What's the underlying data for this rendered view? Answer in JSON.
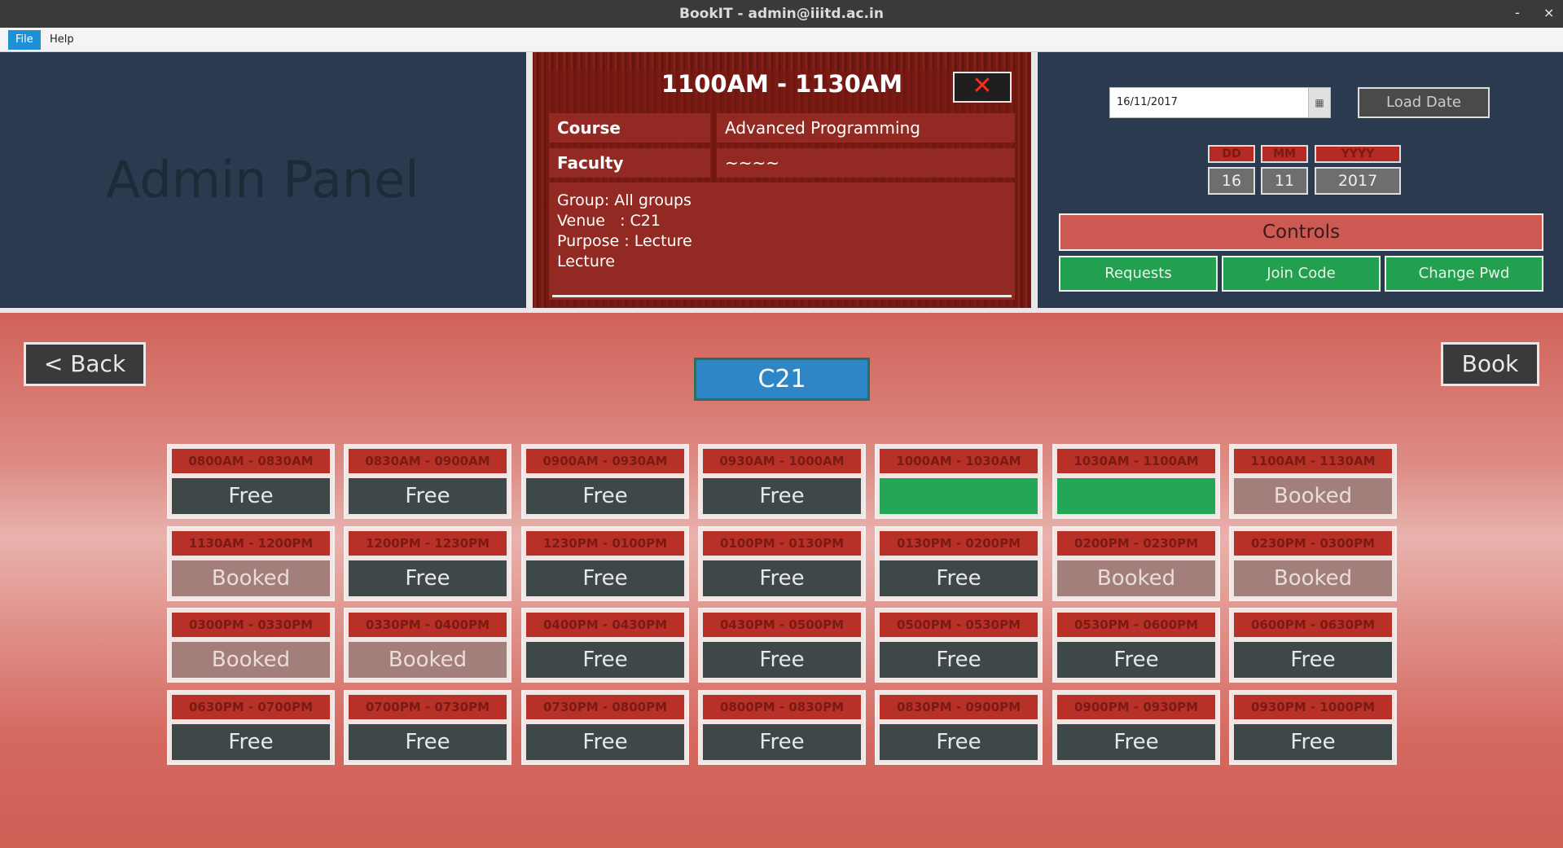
{
  "window": {
    "title": "BookIT - admin@iiitd.ac.in",
    "minimize": "-",
    "close": "×"
  },
  "menu": {
    "items": [
      "File",
      "Help"
    ]
  },
  "panel_title": "Admin Panel",
  "popup": {
    "slot": "1100AM - 1130AM",
    "close": "✕",
    "course_label": "Course",
    "course_value": "Advanced Programming",
    "faculty_label": "Faculty",
    "faculty_value": "~~~~",
    "details": "Group: All groups\nVenue   : C21\nPurpose : Lecture\nLecture"
  },
  "date_picker": {
    "value": "16/11/2017",
    "calendar_icon": "calendar-icon",
    "load_label": "Load Date",
    "dd_label": "DD",
    "mm_label": "MM",
    "yyyy_label": "YYYY",
    "dd": "16",
    "mm": "11",
    "yyyy": "2017"
  },
  "controls": {
    "title": "Controls",
    "requests": "Requests",
    "join_code": "Join Code",
    "change_pwd": "Change Pwd"
  },
  "nav": {
    "back": "< Back",
    "book": "Book"
  },
  "room": "C21",
  "colors": {
    "free": "#3e4849",
    "booked": "#a37f7c",
    "selected": "#24a657",
    "slot_header": "#b83128"
  },
  "slots": [
    {
      "time": "0800AM - 0830AM",
      "status": "Free",
      "state": "free"
    },
    {
      "time": "0830AM - 0900AM",
      "status": "Free",
      "state": "free"
    },
    {
      "time": "0900AM - 0930AM",
      "status": "Free",
      "state": "free"
    },
    {
      "time": "0930AM - 1000AM",
      "status": "Free",
      "state": "free"
    },
    {
      "time": "1000AM - 1030AM",
      "status": "",
      "state": "selected"
    },
    {
      "time": "1030AM - 1100AM",
      "status": "",
      "state": "selected"
    },
    {
      "time": "1100AM - 1130AM",
      "status": "Booked",
      "state": "booked"
    },
    {
      "time": "1130AM - 1200PM",
      "status": "Booked",
      "state": "booked"
    },
    {
      "time": "1200PM - 1230PM",
      "status": "Free",
      "state": "free"
    },
    {
      "time": "1230PM - 0100PM",
      "status": "Free",
      "state": "free"
    },
    {
      "time": "0100PM - 0130PM",
      "status": "Free",
      "state": "free"
    },
    {
      "time": "0130PM - 0200PM",
      "status": "Free",
      "state": "free"
    },
    {
      "time": "0200PM - 0230PM",
      "status": "Booked",
      "state": "booked"
    },
    {
      "time": "0230PM - 0300PM",
      "status": "Booked",
      "state": "booked"
    },
    {
      "time": "0300PM - 0330PM",
      "status": "Booked",
      "state": "booked"
    },
    {
      "time": "0330PM - 0400PM",
      "status": "Booked",
      "state": "booked"
    },
    {
      "time": "0400PM - 0430PM",
      "status": "Free",
      "state": "free"
    },
    {
      "time": "0430PM - 0500PM",
      "status": "Free",
      "state": "free"
    },
    {
      "time": "0500PM - 0530PM",
      "status": "Free",
      "state": "free"
    },
    {
      "time": "0530PM - 0600PM",
      "status": "Free",
      "state": "free"
    },
    {
      "time": "0600PM - 0630PM",
      "status": "Free",
      "state": "free"
    },
    {
      "time": "0630PM - 0700PM",
      "status": "Free",
      "state": "free"
    },
    {
      "time": "0700PM - 0730PM",
      "status": "Free",
      "state": "free"
    },
    {
      "time": "0730PM - 0800PM",
      "status": "Free",
      "state": "free"
    },
    {
      "time": "0800PM - 0830PM",
      "status": "Free",
      "state": "free"
    },
    {
      "time": "0830PM - 0900PM",
      "status": "Free",
      "state": "free"
    },
    {
      "time": "0900PM - 0930PM",
      "status": "Free",
      "state": "free"
    },
    {
      "time": "0930PM - 1000PM",
      "status": "Free",
      "state": "free"
    }
  ]
}
